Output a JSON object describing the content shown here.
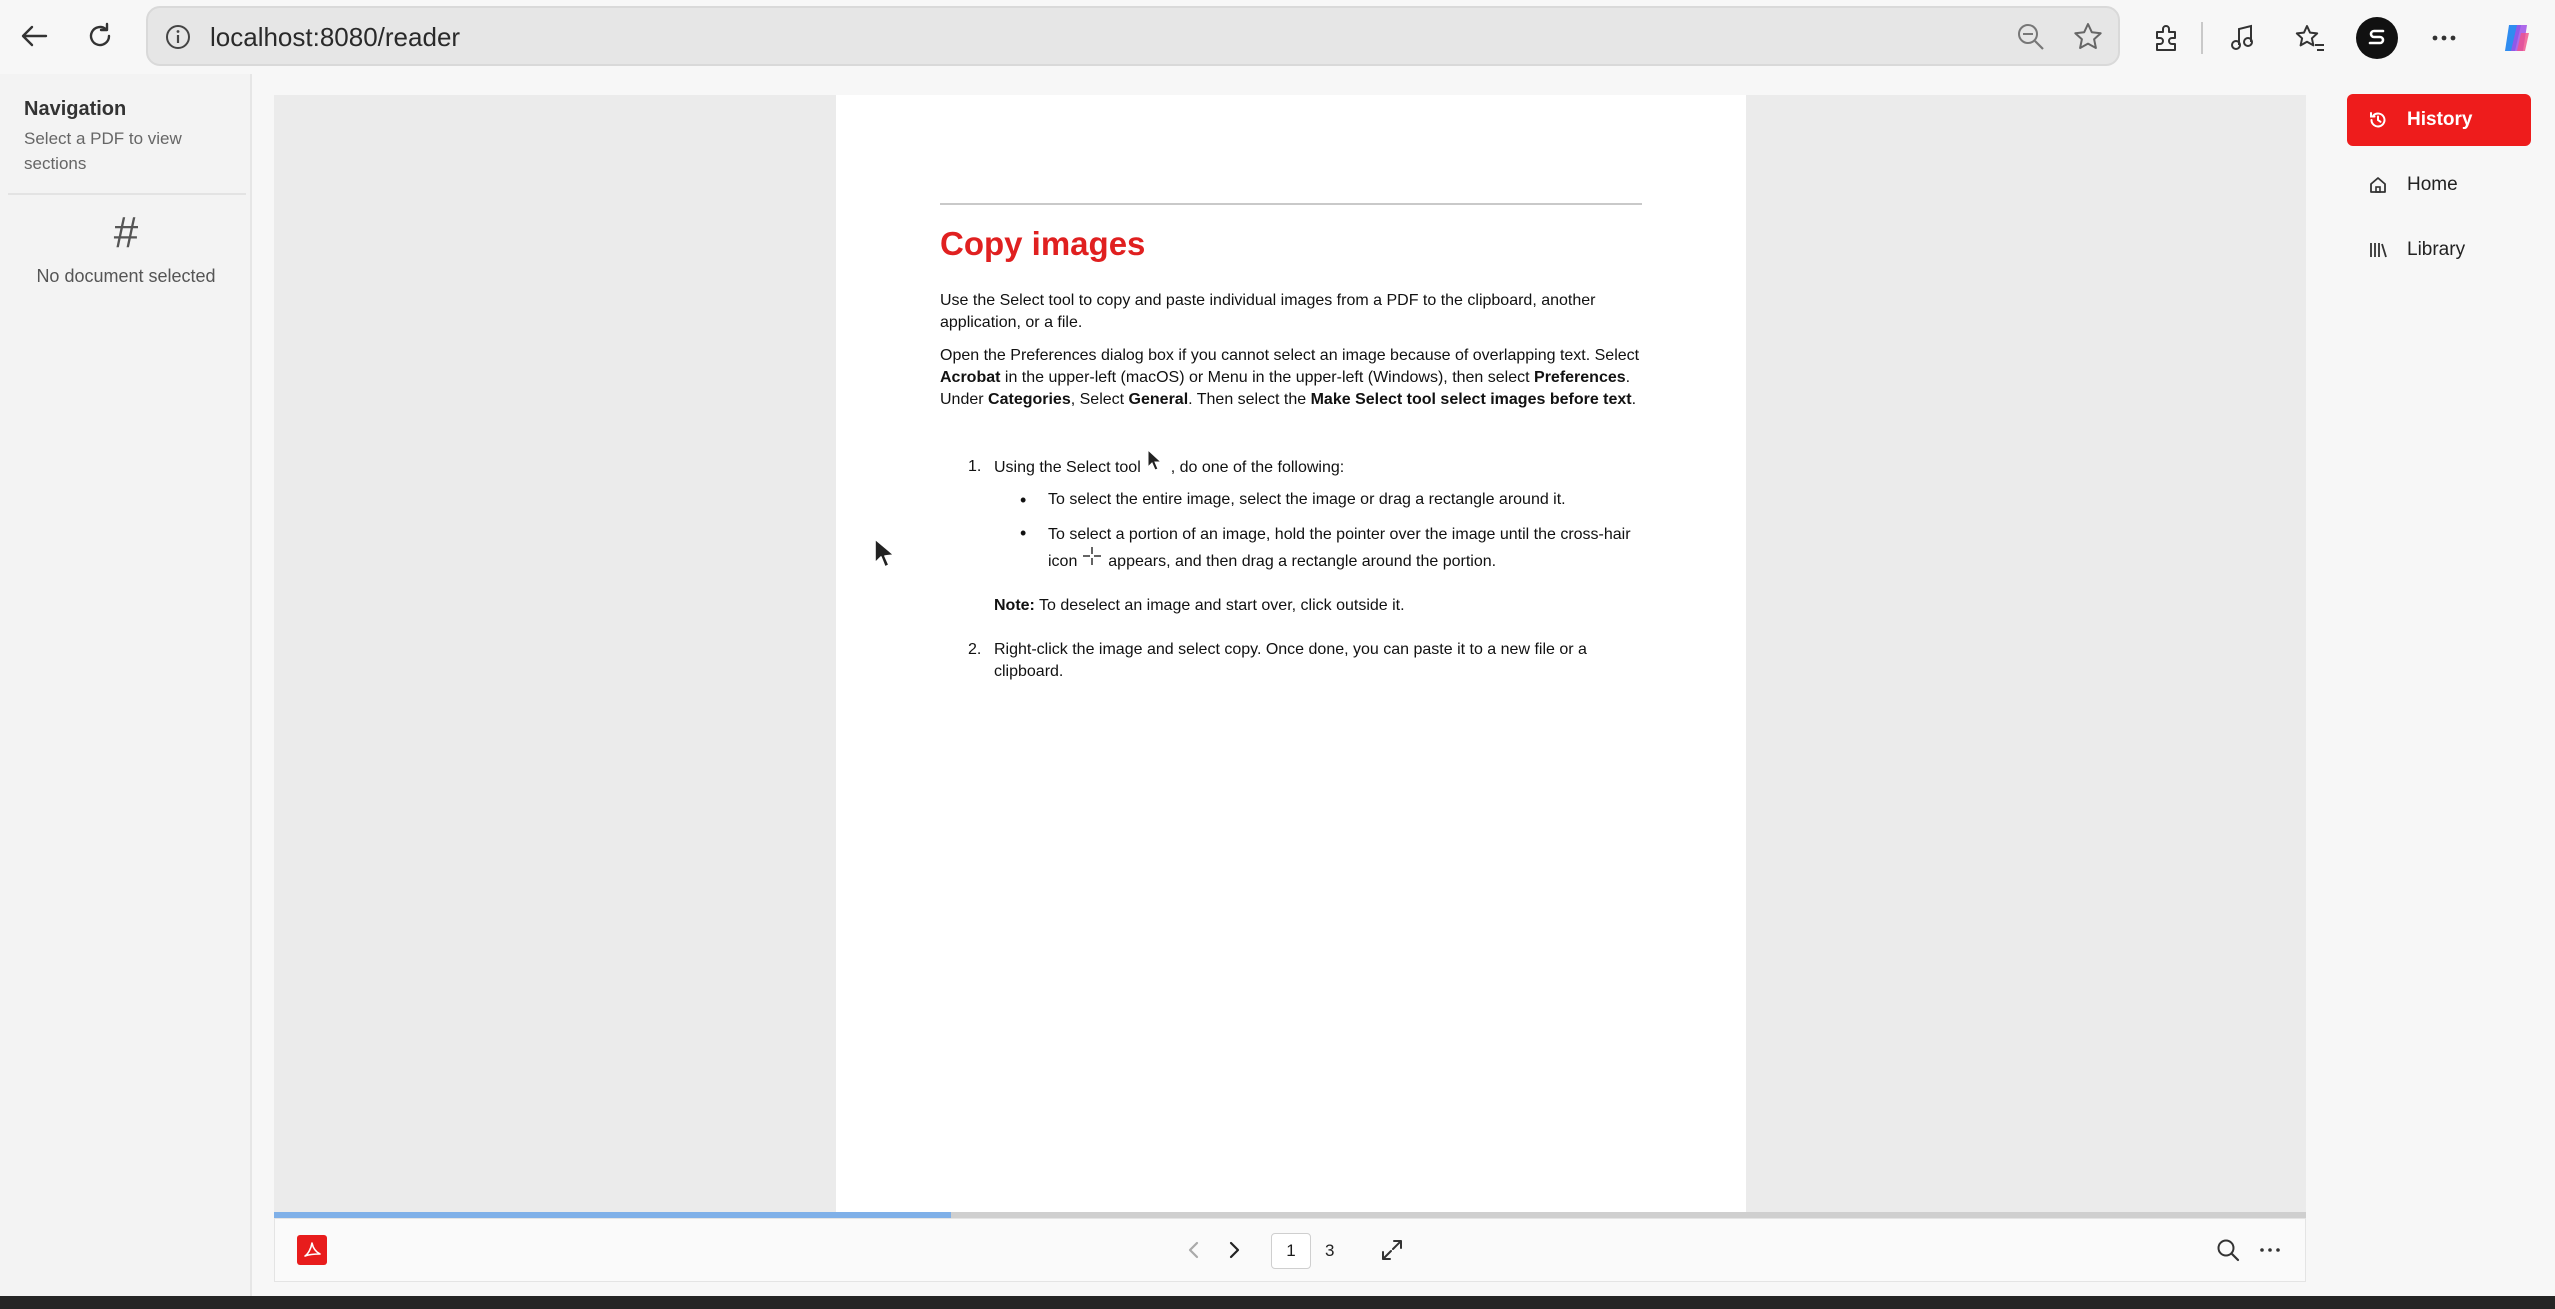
{
  "browser": {
    "url": "localhost:8080/reader"
  },
  "left_panel": {
    "title": "Navigation",
    "subtitle": "Select a PDF to view sections",
    "hash_symbol": "#",
    "empty_text": "No document selected"
  },
  "document": {
    "heading": "Copy images",
    "para1": "Use the Select tool to copy and paste individual images from a PDF to the clipboard, another application, or a file.",
    "para2_parts": {
      "a": "Open the Preferences dialog box if you cannot select an image because of overlapping text. Select ",
      "b": "Acrobat",
      "c": " in the upper-left (macOS) or Menu in the upper-left (Windows), then select ",
      "d": "Preferences",
      "e": ". Under ",
      "f": "Categories",
      "g": ", Select ",
      "h": "General",
      "i": ". Then select the ",
      "j": "Make Select tool select images before text",
      "k": "."
    },
    "step1_num": "1.",
    "step1_a": "Using the Select tool",
    "step1_b": ", do one of the following:",
    "bullet1": "To select the entire image, select the image or drag a rectangle around it.",
    "bullet2_a": "To select a portion of an image, hold the pointer over the image until the cross-hair icon",
    "bullet2_b": "appears, and then drag a rectangle around the portion.",
    "note_label": "Note:",
    "note_text": " To deselect an image and start over, click outside it.",
    "step2_num": "2.",
    "step2": "Right-click the image and select copy. Once done, you can paste it to a new file or a clipboard."
  },
  "reader": {
    "progress": 0.333,
    "current_page": "1",
    "total_pages": "3"
  },
  "right_panel": {
    "items": [
      {
        "label": "History",
        "icon": "history-icon",
        "active": true
      },
      {
        "label": "Home",
        "icon": "home-icon",
        "active": false
      },
      {
        "label": "Library",
        "icon": "library-icon",
        "active": false
      }
    ]
  },
  "colors": {
    "accent": "#ee1c1c",
    "heading": "#e02020",
    "progress": "#7fb0e8"
  }
}
